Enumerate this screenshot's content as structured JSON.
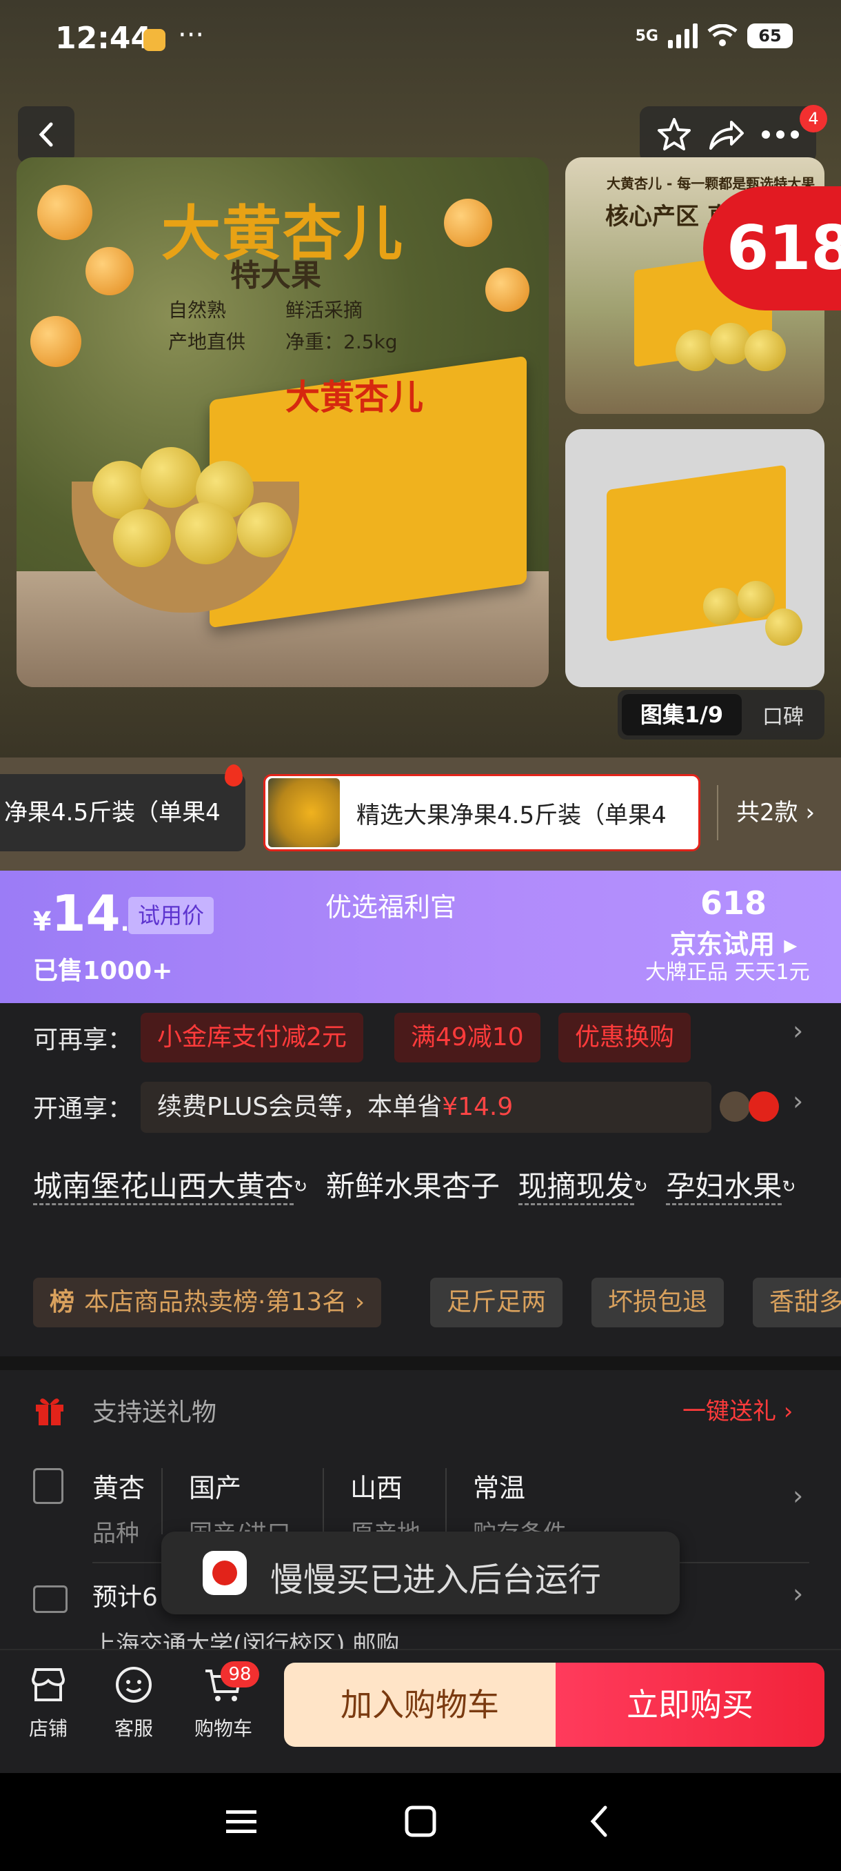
{
  "status_bar": {
    "time": "12:44",
    "dots": "···",
    "network": "5G",
    "battery": "65"
  },
  "header": {
    "notif_count": "4"
  },
  "hero": {
    "main_title": "大黄杏儿",
    "main_subtitle": "特大果",
    "features": [
      "自然熟",
      "鲜活采摘",
      "产地直供",
      "净重：2.5kg"
    ],
    "box_label": "大黄杏儿",
    "side1_title": "大黄杏儿 - 每一颗都是甄选特大果",
    "side1_core": "核心产区 直",
    "badge_618": "618",
    "gallery_label": "图集1/9",
    "review_label": "口碑"
  },
  "variants": {
    "left_label": "净果4.5斤装（单果4",
    "selected_label": "精选大果净果4.5斤装（单果4",
    "count_label": "共2款 ›"
  },
  "price_banner": {
    "yen": "¥",
    "price_int": "14",
    "price_dec": ".9",
    "trial_tag": "试用价",
    "sold": "已售1000+",
    "welfare": "优选福利官",
    "event": "618",
    "jd_trial": "京东试用 ▸",
    "brand_line": "大牌正品 天天1元"
  },
  "offers": {
    "label": "可再享：",
    "chips": [
      "小金库支付减2元",
      "满49减10",
      "优惠换购"
    ]
  },
  "plus": {
    "label": "开通享：",
    "text": "续费PLUS会员等，本单省",
    "amount": "¥14.9"
  },
  "product_title": {
    "seg1": "城南堡花山西大黄杏",
    "seg2": "新鲜水果杏子",
    "seg3": "现摘现发",
    "seg4": "孕妇水果"
  },
  "tags": {
    "rank_icon": "榜",
    "rank": "本店商品热卖榜·第13名 ›",
    "items": [
      "足斤足两",
      "坏损包退",
      "香甜多"
    ]
  },
  "gift": {
    "label": "支持送礼物",
    "link": "一键送礼 ›"
  },
  "attributes": [
    {
      "value": "黄杏",
      "key": "品种"
    },
    {
      "value": "国产",
      "key": "国产/进口"
    },
    {
      "value": "山西",
      "key": "原产地"
    },
    {
      "value": "常温",
      "key": "贮存条件"
    }
  ],
  "shipping": {
    "text": "预计6",
    "sub": "上海交通大学(闵行校区)  邮购"
  },
  "toast": {
    "text": "慢慢买已进入后台运行"
  },
  "bottom_bar": {
    "store": "店铺",
    "service": "客服",
    "cart": "购物车",
    "cart_count": "98",
    "add_to_cart": "加入购物车",
    "buy_now": "立即购买"
  },
  "colors": {
    "accent_red": "#e2231a",
    "price_banner": "#a98af9",
    "plus_red": "#ff4545"
  }
}
